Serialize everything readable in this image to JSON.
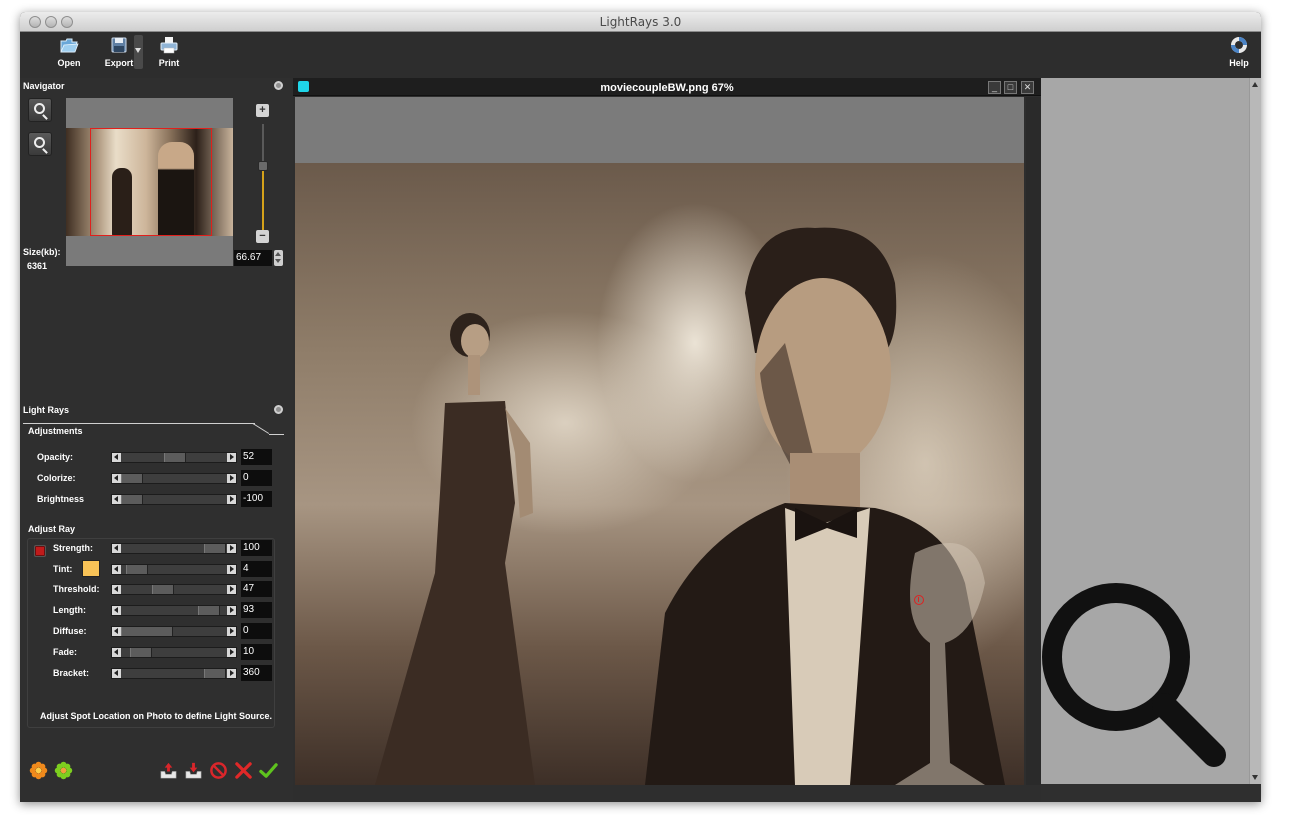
{
  "window": {
    "title": "LightRays 3.0"
  },
  "toolbar": {
    "open_label": "Open",
    "export_label": "Export",
    "print_label": "Print",
    "help_label": "Help"
  },
  "navigator": {
    "title": "Navigator",
    "size_label": "Size(kb):",
    "size_value": "6361",
    "zoom_value": "66.67",
    "zoom_in_symbol": "+",
    "zoom_out_symbol": "−",
    "zoom_level_fraction": 0.62
  },
  "light_rays": {
    "title": "Light Rays",
    "tab_label": "Adjustments",
    "adjustments": [
      {
        "label": "Opacity:",
        "value": "52"
      },
      {
        "label": "Colorize:",
        "value": "0"
      },
      {
        "label": "Brightness",
        "value": "-100"
      }
    ],
    "adjust_ray_title": "Adjust Ray",
    "ray": [
      {
        "label": "Strength:",
        "value": "100"
      },
      {
        "label": "Tint:",
        "value": "4"
      },
      {
        "label": "Threshold:",
        "value": "47"
      },
      {
        "label": "Length:",
        "value": "93"
      },
      {
        "label": "Diffuse:",
        "value": "0"
      },
      {
        "label": "Fade:",
        "value": "10"
      },
      {
        "label": "Bracket:",
        "value": "360"
      }
    ],
    "tint_color": "#f8c357",
    "hint": "Adjust Spot Location on Photo to define Light Source."
  },
  "image_window": {
    "title": "moviecoupleBW.png 67%",
    "minimize_symbol": "_",
    "maximize_symbol": "□",
    "close_symbol": "✕"
  },
  "icons": {
    "open": "folder-open-icon",
    "export": "floppy-disk-icon",
    "print": "printer-icon",
    "help": "lifebuoy-icon",
    "zoom_in": "zoom-in-icon",
    "zoom_out": "zoom-out-icon",
    "preset_a": "orange-flower-icon",
    "preset_b": "green-flower-icon",
    "import": "inbox-upload-icon",
    "export_preset": "inbox-download-icon",
    "reset": "no-entry-icon",
    "cancel": "red-x-icon",
    "apply": "green-check-icon",
    "search": "magnifier-icon"
  },
  "colors": {
    "accent_red": "#c01b1b",
    "nav_frame": "#e0201c",
    "zoom_fill": "#d5a21a",
    "image_tab_icon": "#1fd5e8"
  }
}
